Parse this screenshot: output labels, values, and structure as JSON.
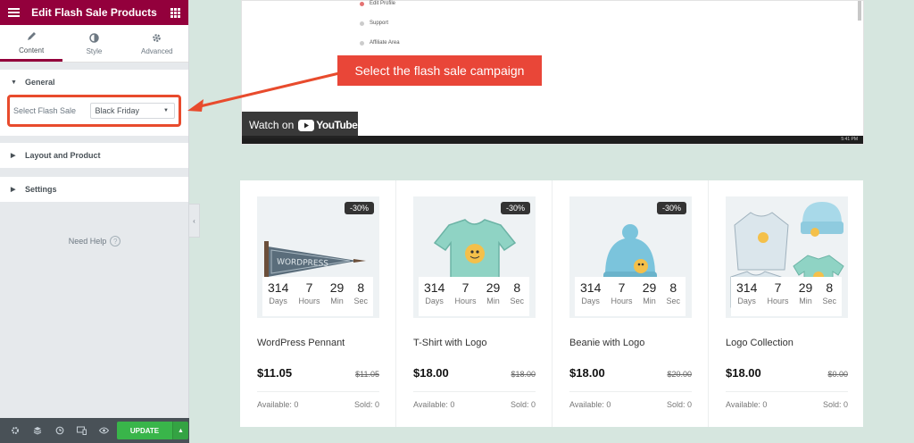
{
  "panel": {
    "title": "Edit Flash Sale Products",
    "tabs": [
      {
        "label": "Content",
        "icon": "pencil-icon"
      },
      {
        "label": "Style",
        "icon": "contrast-icon"
      },
      {
        "label": "Advanced",
        "icon": "gear-icon"
      }
    ],
    "sections": {
      "general": "General",
      "layout": "Layout and Product",
      "settings": "Settings"
    },
    "flash_sale": {
      "label": "Select Flash Sale",
      "value": "Black Friday"
    },
    "need_help": "Need Help",
    "update_label": "UPDATE",
    "accent": "#93003c",
    "update_color": "#39b54a"
  },
  "video": {
    "menu_items": [
      "Edit Profile",
      "Support",
      "Affiliate Area"
    ],
    "watch_on": "Watch on",
    "youtube": "YouTube",
    "time": "5:41 PM"
  },
  "callout": {
    "text": "Select the flash sale campaign",
    "color": "#e94638"
  },
  "products": [
    {
      "name": "WordPress Pennant",
      "price": "$11.05",
      "old_price": "$11.05",
      "badge": "-30%",
      "days": "314",
      "hours": "7",
      "min": "29",
      "sec": "8",
      "available": "Available: 0",
      "sold": "Sold: 0",
      "image": "pennant"
    },
    {
      "name": "T-Shirt with Logo",
      "price": "$18.00",
      "old_price": "$18.00",
      "badge": "-30%",
      "days": "314",
      "hours": "7",
      "min": "29",
      "sec": "8",
      "available": "Available: 0",
      "sold": "Sold: 0",
      "image": "tshirt"
    },
    {
      "name": "Beanie with Logo",
      "price": "$18.00",
      "old_price": "$20.00",
      "badge": "-30%",
      "days": "314",
      "hours": "7",
      "min": "29",
      "sec": "8",
      "available": "Available: 0",
      "sold": "Sold: 0",
      "image": "beanie"
    },
    {
      "name": "Logo Collection",
      "price": "$18.00",
      "old_price": "$0.00",
      "badge": "",
      "days": "314",
      "hours": "7",
      "min": "29",
      "sec": "8",
      "available": "Available: 0",
      "sold": "Sold: 0",
      "image": "collection"
    }
  ],
  "countdown_units": {
    "days": "Days",
    "hours": "Hours",
    "min": "Min",
    "sec": "Sec"
  }
}
